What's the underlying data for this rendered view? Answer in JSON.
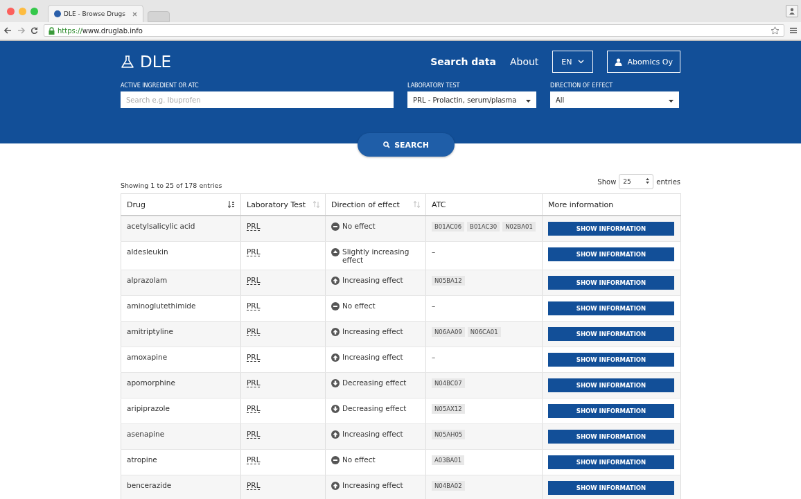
{
  "browser": {
    "tab_title": "DLE - Browse Drugs",
    "url_scheme": "https://",
    "url_rest": "www.druglab.info"
  },
  "header": {
    "logo": "DLE",
    "nav": [
      {
        "label": "Search data",
        "selected": true
      },
      {
        "label": "About",
        "selected": false
      }
    ],
    "language": "EN",
    "account": "Abomics Oy"
  },
  "search": {
    "ingredient": {
      "label": "ACTIVE INGREDIENT OR ATC",
      "placeholder": "Search e.g. Ibuprofen"
    },
    "lab_test": {
      "label": "LABORATORY TEST",
      "value": "PRL - Prolactin, serum/plasma"
    },
    "direction": {
      "label": "DIRECTION OF EFFECT",
      "value": "All"
    },
    "button": "SEARCH"
  },
  "table_info": "Showing 1 to 25 of 178 entries",
  "length": {
    "before": "Show",
    "value": "25",
    "after": "entries"
  },
  "table": {
    "columns": [
      {
        "label": "Drug",
        "sorted": true
      },
      {
        "label": "Laboratory Test",
        "sorted": false
      },
      {
        "label": "Direction of effect",
        "sorted": false
      },
      {
        "label": "ATC"
      },
      {
        "label": "More information"
      }
    ],
    "rows": [
      {
        "drug": "acetylsalicylic acid",
        "test": "PRL",
        "kind": "none",
        "effect": "No effect",
        "atc": [
          "B01AC06",
          "B01AC30",
          "N02BA01"
        ],
        "button": "SHOW INFORMATION"
      },
      {
        "drug": "aldesleukin",
        "test": "PRL",
        "kind": "slight",
        "effect": "Slightly increasing effect",
        "atc": [],
        "atc_empty": "–",
        "button": "SHOW INFORMATION"
      },
      {
        "drug": "alprazolam",
        "test": "PRL",
        "kind": "increase",
        "effect": "Increasing effect",
        "atc": [
          "N05BA12"
        ],
        "button": "SHOW INFORMATION"
      },
      {
        "drug": "aminoglutethimide",
        "test": "PRL",
        "kind": "none",
        "effect": "No effect",
        "atc": [],
        "atc_empty": "–",
        "button": "SHOW INFORMATION"
      },
      {
        "drug": "amitriptyline",
        "test": "PRL",
        "kind": "increase",
        "effect": "Increasing effect",
        "atc": [
          "N06AA09",
          "N06CA01"
        ],
        "button": "SHOW INFORMATION"
      },
      {
        "drug": "amoxapine",
        "test": "PRL",
        "kind": "increase",
        "effect": "Increasing effect",
        "atc": [],
        "atc_empty": "–",
        "button": "SHOW INFORMATION"
      },
      {
        "drug": "apomorphine",
        "test": "PRL",
        "kind": "decrease",
        "effect": "Decreasing effect",
        "atc": [
          "N04BC07"
        ],
        "button": "SHOW INFORMATION"
      },
      {
        "drug": "aripiprazole",
        "test": "PRL",
        "kind": "decrease",
        "effect": "Decreasing effect",
        "atc": [
          "N05AX12"
        ],
        "button": "SHOW INFORMATION"
      },
      {
        "drug": "asenapine",
        "test": "PRL",
        "kind": "increase",
        "effect": "Increasing effect",
        "atc": [
          "N05AH05"
        ],
        "button": "SHOW INFORMATION"
      },
      {
        "drug": "atropine",
        "test": "PRL",
        "kind": "none",
        "effect": "No effect",
        "atc": [
          "A03BA01"
        ],
        "button": "SHOW INFORMATION"
      },
      {
        "drug": "bencerazide",
        "test": "PRL",
        "kind": "increase",
        "effect": "Increasing effect",
        "atc": [
          "N04BA02"
        ],
        "button": "SHOW INFORMATION"
      }
    ]
  }
}
